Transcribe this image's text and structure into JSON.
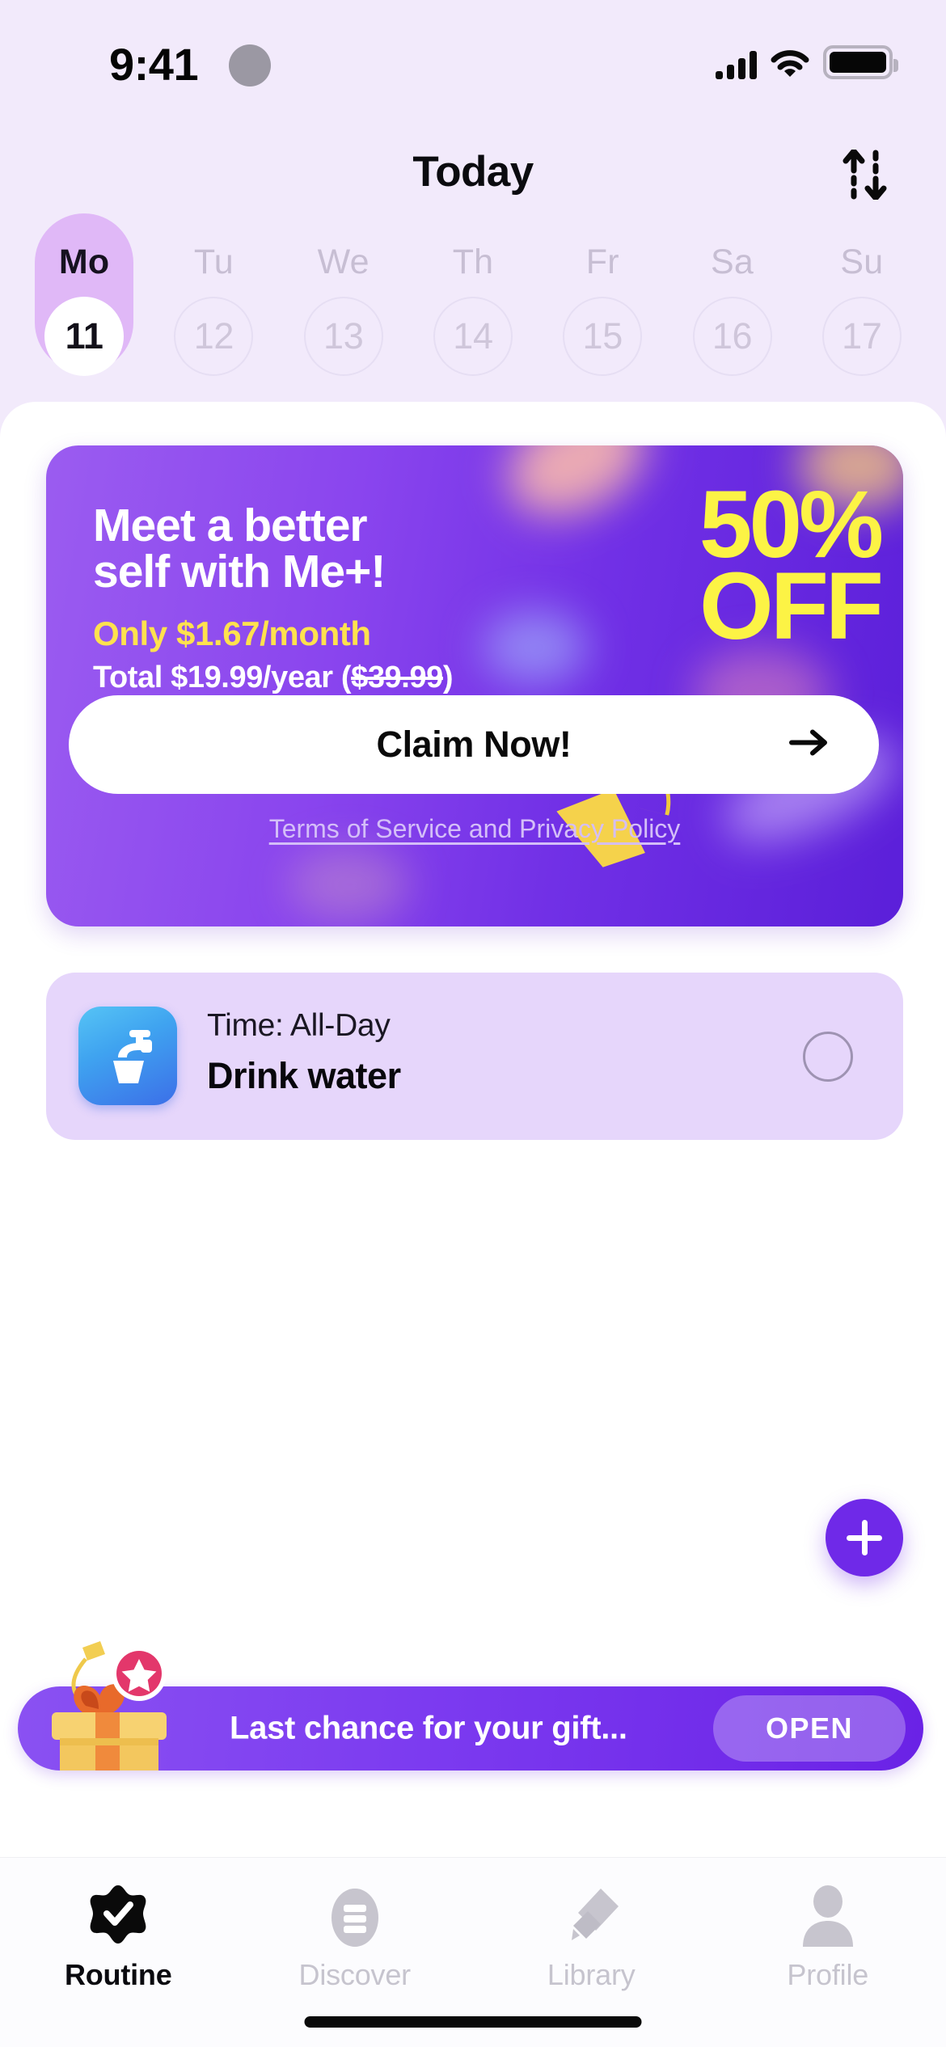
{
  "status_bar": {
    "time": "9:41",
    "signal_icon": "cellular-signal-icon",
    "wifi_icon": "wifi-icon",
    "battery_icon": "battery-full-icon"
  },
  "header": {
    "title": "Today",
    "sort_icon": "sort-arrows-icon"
  },
  "week_strip": {
    "days": [
      {
        "dow": "Mo",
        "date": "11",
        "selected": true
      },
      {
        "dow": "Tu",
        "date": "12",
        "selected": false
      },
      {
        "dow": "We",
        "date": "13",
        "selected": false
      },
      {
        "dow": "Th",
        "date": "14",
        "selected": false
      },
      {
        "dow": "Fr",
        "date": "15",
        "selected": false
      },
      {
        "dow": "Sa",
        "date": "16",
        "selected": false
      },
      {
        "dow": "Su",
        "date": "17",
        "selected": false
      }
    ]
  },
  "promo": {
    "headline_line1": "Meet a better",
    "headline_line2": "self with Me+!",
    "price_monthly": "Only $1.67/month",
    "price_total_prefix": "Total $19.99/year (",
    "price_old": "$39.99",
    "price_total_suffix": ")",
    "discount_line1": "50%",
    "discount_line2": "OFF",
    "cta_label": "Claim Now!",
    "cta_arrow_icon": "arrow-right-icon",
    "terms_label": "Terms of Service and Privacy Policy",
    "gradient_from": "#9B5CF0",
    "gradient_to": "#5B1FD9",
    "accent_yellow": "#FCF345",
    "price_yellow": "#FFE14E"
  },
  "task": {
    "icon": "water-faucet-icon",
    "time_label": "Time: All-Day",
    "title": "Drink water",
    "checkbox_icon": "empty-circle-checkbox",
    "checked": false,
    "card_color": "#E6D6FB"
  },
  "fab": {
    "icon": "plus-icon",
    "color": "#6F29E8"
  },
  "gift_banner": {
    "icon": "gift-box-icon",
    "badge_icon": "star-badge-icon",
    "message": "Last chance for your gift...",
    "button_label": "OPEN",
    "gradient_from": "#8A51F2",
    "gradient_to": "#6A22E6"
  },
  "tab_bar": {
    "tabs": [
      {
        "label": "Routine",
        "icon": "seal-check-icon",
        "active": true
      },
      {
        "label": "Discover",
        "icon": "discover-list-icon",
        "active": false
      },
      {
        "label": "Library",
        "icon": "bookmarks-diamond-icon",
        "active": false
      },
      {
        "label": "Profile",
        "icon": "person-icon",
        "active": false
      }
    ]
  },
  "home_indicator": {
    "icon": "home-indicator-bar"
  }
}
